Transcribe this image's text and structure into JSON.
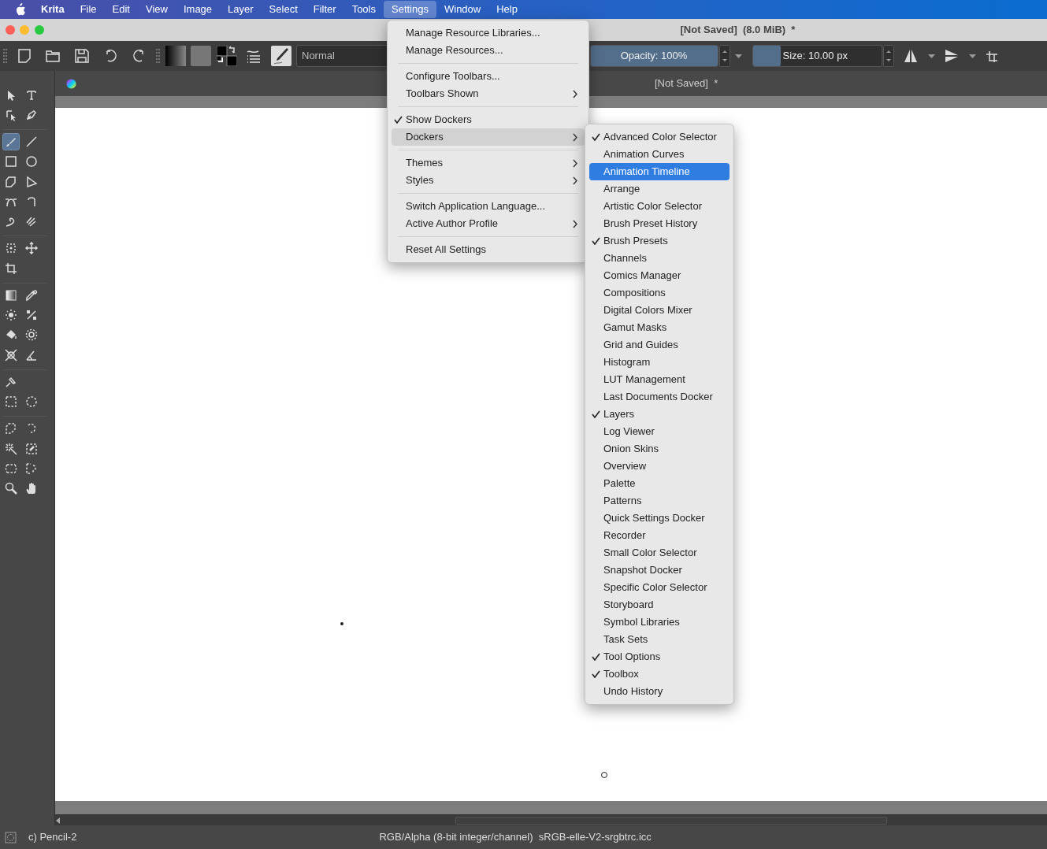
{
  "menu_bar": {
    "app": "Krita",
    "items": [
      {
        "label": "File",
        "selected": false
      },
      {
        "label": "Edit",
        "selected": false
      },
      {
        "label": "View",
        "selected": false
      },
      {
        "label": "Image",
        "selected": false
      },
      {
        "label": "Layer",
        "selected": false
      },
      {
        "label": "Select",
        "selected": false
      },
      {
        "label": "Filter",
        "selected": false
      },
      {
        "label": "Tools",
        "selected": false
      },
      {
        "label": "Settings",
        "selected": true
      },
      {
        "label": "Window",
        "selected": false
      },
      {
        "label": "Help",
        "selected": false
      }
    ]
  },
  "window": {
    "title": "[Not Saved]  (8.0 MiB)  *"
  },
  "toolbar": {
    "blend_mode": "Normal",
    "opacity": {
      "label": "Opacity: 100%",
      "level": 1.0
    },
    "size": {
      "label": "Size: 10.00 px",
      "level": 0.22
    }
  },
  "document_tab": "[Not Saved]  *",
  "toolbox": [
    [
      {
        "selected": false
      },
      {
        "selected": false
      }
    ],
    [
      {
        "selected": false
      },
      {
        "selected": false
      }
    ],
    [
      {
        "selected": true
      },
      {
        "selected": false
      }
    ],
    [
      {
        "selected": false
      },
      {
        "selected": false
      }
    ],
    [
      {
        "selected": false
      },
      {
        "selected": false
      }
    ],
    [
      {
        "selected": false
      },
      {
        "selected": false
      }
    ],
    [
      {
        "selected": false
      },
      {
        "selected": false
      }
    ],
    [
      {
        "selected": false
      },
      {
        "selected": false
      }
    ],
    [
      {
        "selected": false
      }
    ],
    [
      {
        "selected": false
      },
      {
        "selected": false
      }
    ],
    [
      {
        "selected": false
      },
      {
        "selected": false
      }
    ],
    [
      {
        "selected": false
      },
      {
        "selected": false
      }
    ],
    [
      {
        "selected": false
      },
      {
        "selected": false
      }
    ],
    [
      {
        "selected": false
      }
    ],
    [
      {
        "selected": false
      },
      {
        "selected": false
      }
    ],
    [
      {
        "selected": false
      },
      {
        "selected": false
      }
    ],
    [
      {
        "selected": false
      },
      {
        "selected": false
      }
    ],
    [
      {
        "selected": false
      },
      {
        "selected": false
      }
    ],
    [
      {
        "selected": false
      },
      {
        "selected": false
      }
    ]
  ],
  "settings_menu": [
    {
      "kind": "item",
      "label": "Manage Resource Libraries...",
      "checked": false,
      "submenu": false,
      "selected": false
    },
    {
      "kind": "item",
      "label": "Manage Resources...",
      "checked": false,
      "submenu": false,
      "selected": false
    },
    {
      "kind": "separator"
    },
    {
      "kind": "item",
      "label": "Configure Toolbars...",
      "checked": false,
      "submenu": false,
      "selected": false
    },
    {
      "kind": "item",
      "label": "Toolbars Shown",
      "checked": false,
      "submenu": true,
      "selected": false
    },
    {
      "kind": "separator"
    },
    {
      "kind": "item",
      "label": "Show Dockers",
      "checked": true,
      "submenu": false,
      "selected": false
    },
    {
      "kind": "item",
      "label": "Dockers",
      "checked": false,
      "submenu": true,
      "selected": true
    },
    {
      "kind": "separator"
    },
    {
      "kind": "item",
      "label": "Themes",
      "checked": false,
      "submenu": true,
      "selected": false
    },
    {
      "kind": "item",
      "label": "Styles",
      "checked": false,
      "submenu": true,
      "selected": false
    },
    {
      "kind": "separator"
    },
    {
      "kind": "item",
      "label": "Switch Application Language...",
      "checked": false,
      "submenu": false,
      "selected": false
    },
    {
      "kind": "item",
      "label": "Active Author Profile",
      "checked": false,
      "submenu": true,
      "selected": false
    },
    {
      "kind": "separator"
    },
    {
      "kind": "item",
      "label": "Reset All Settings",
      "checked": false,
      "submenu": false,
      "selected": false
    }
  ],
  "dockers_menu": [
    {
      "label": "Advanced Color Selector",
      "checked": true,
      "selected": false
    },
    {
      "label": "Animation Curves",
      "checked": false,
      "selected": false
    },
    {
      "label": "Animation Timeline",
      "checked": false,
      "selected": true
    },
    {
      "label": "Arrange",
      "checked": false,
      "selected": false
    },
    {
      "label": "Artistic Color Selector",
      "checked": false,
      "selected": false
    },
    {
      "label": "Brush Preset History",
      "checked": false,
      "selected": false
    },
    {
      "label": "Brush Presets",
      "checked": true,
      "selected": false
    },
    {
      "label": "Channels",
      "checked": false,
      "selected": false
    },
    {
      "label": "Comics Manager",
      "checked": false,
      "selected": false
    },
    {
      "label": "Compositions",
      "checked": false,
      "selected": false
    },
    {
      "label": "Digital Colors Mixer",
      "checked": false,
      "selected": false
    },
    {
      "label": "Gamut Masks",
      "checked": false,
      "selected": false
    },
    {
      "label": "Grid and Guides",
      "checked": false,
      "selected": false
    },
    {
      "label": "Histogram",
      "checked": false,
      "selected": false
    },
    {
      "label": "LUT Management",
      "checked": false,
      "selected": false
    },
    {
      "label": "Last Documents Docker",
      "checked": false,
      "selected": false
    },
    {
      "label": "Layers",
      "checked": true,
      "selected": false
    },
    {
      "label": "Log Viewer",
      "checked": false,
      "selected": false
    },
    {
      "label": "Onion Skins",
      "checked": false,
      "selected": false
    },
    {
      "label": "Overview",
      "checked": false,
      "selected": false
    },
    {
      "label": "Palette",
      "checked": false,
      "selected": false
    },
    {
      "label": "Patterns",
      "checked": false,
      "selected": false
    },
    {
      "label": "Quick Settings Docker",
      "checked": false,
      "selected": false
    },
    {
      "label": "Recorder",
      "checked": false,
      "selected": false
    },
    {
      "label": "Small Color Selector",
      "checked": false,
      "selected": false
    },
    {
      "label": "Snapshot Docker",
      "checked": false,
      "selected": false
    },
    {
      "label": "Specific Color Selector",
      "checked": false,
      "selected": false
    },
    {
      "label": "Storyboard",
      "checked": false,
      "selected": false
    },
    {
      "label": "Symbol Libraries",
      "checked": false,
      "selected": false
    },
    {
      "label": "Task Sets",
      "checked": false,
      "selected": false
    },
    {
      "label": "Tool Options",
      "checked": true,
      "selected": false
    },
    {
      "label": "Toolbox",
      "checked": true,
      "selected": false
    },
    {
      "label": "Undo History",
      "checked": false,
      "selected": false
    }
  ],
  "status_bar": {
    "brush": "c) Pencil-2",
    "color_space": "RGB/Alpha (8-bit integer/channel)  sRGB-elle-V2-srgbtrc.icc"
  }
}
